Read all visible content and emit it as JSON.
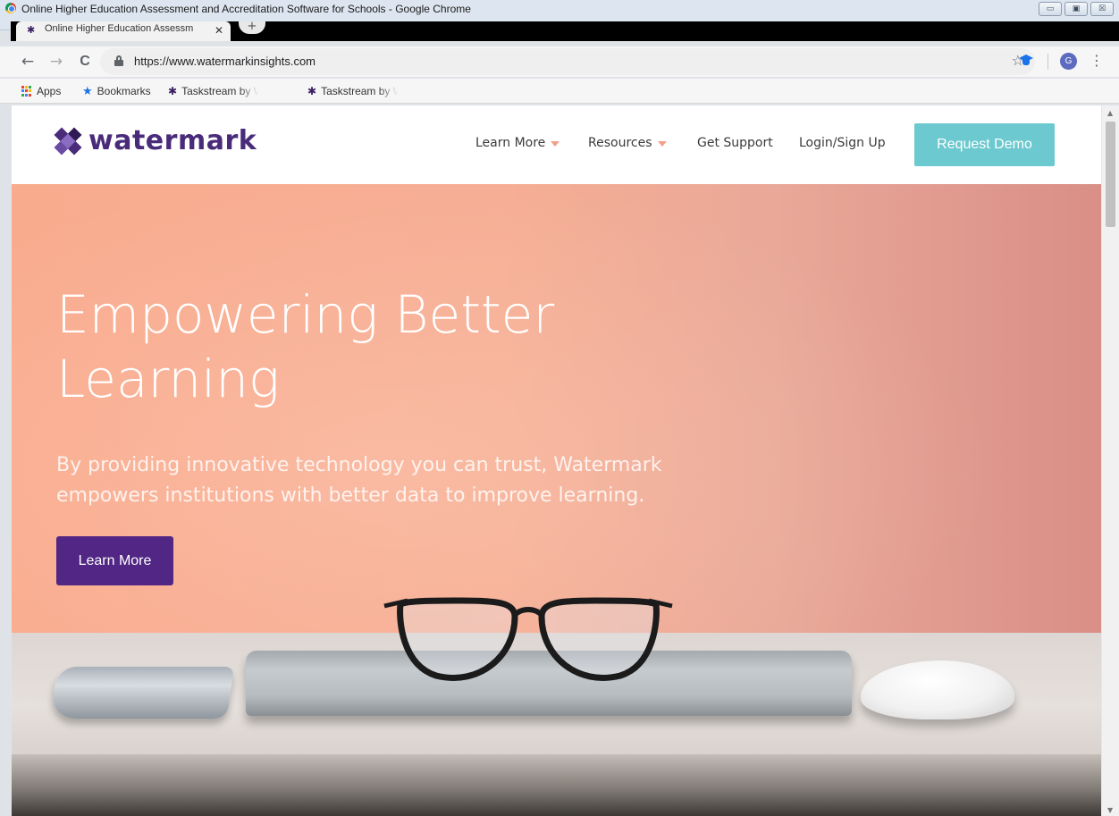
{
  "window": {
    "title": "Online Higher Education Assessment and Accreditation Software for Schools - Google Chrome",
    "controls": [
      "▭",
      "▣",
      "☒"
    ]
  },
  "tab": {
    "title": "Online Higher Education Assessm",
    "close": "✕",
    "new_tab": "+"
  },
  "toolbar": {
    "back": "←",
    "forward": "→",
    "reload": "C",
    "url": "https://www.watermarkinsights.com",
    "avatar_initial": "G",
    "menu": "⋮",
    "star": "☆"
  },
  "bookmarks": [
    {
      "label": "Apps",
      "icon": "apps-grid-icon"
    },
    {
      "label": "Bookmarks",
      "icon": "star-icon"
    },
    {
      "label": "Taskstream by Water",
      "icon": "watermark-logo-icon"
    },
    {
      "label": "Taskstream by Water",
      "icon": "watermark-logo-icon"
    }
  ],
  "site": {
    "logo_text": "watermark",
    "nav": [
      {
        "label": "Learn More",
        "has_dropdown": true
      },
      {
        "label": "Resources",
        "has_dropdown": true
      },
      {
        "label": "Get Support",
        "has_dropdown": false
      },
      {
        "label": "Login/Sign Up",
        "has_dropdown": false
      }
    ],
    "demo_button": "Request Demo"
  },
  "hero": {
    "title_line1": "Empowering Better",
    "title_line2": "Learning",
    "subtitle_line1": "By providing innovative technology you can trust, Watermark",
    "subtitle_line2": "empowers institutions with better data to improve learning.",
    "cta": "Learn More"
  },
  "colors": {
    "brand_purple": "#512684",
    "accent_teal": "#6cc9cf",
    "hero_peach": "#f6ae94",
    "caret_salmon": "#f2a08a"
  }
}
